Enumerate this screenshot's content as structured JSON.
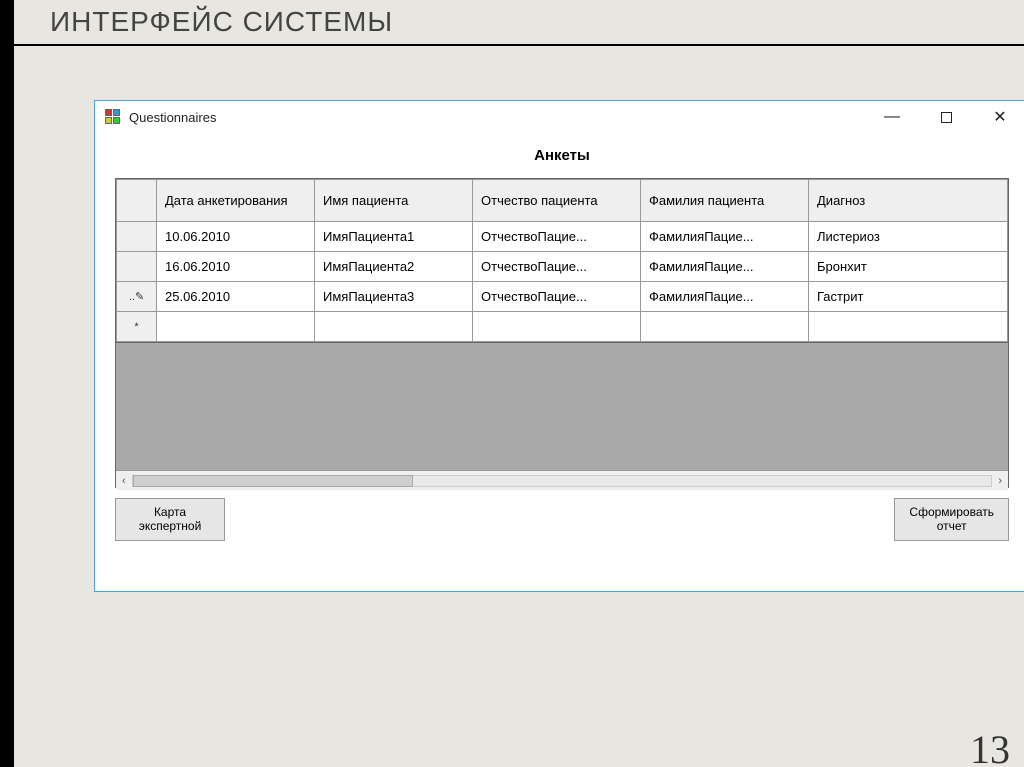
{
  "slide": {
    "title": "ИНТЕРФЕЙС СИСТЕМЫ",
    "page_number": "13"
  },
  "window": {
    "title": "Questionnaires",
    "controls": {
      "minimize": "—",
      "close": "✕"
    },
    "heading": "Анкеты",
    "columns": [
      "Дата анкетирования",
      "Имя пациента",
      "Отчество пациента",
      "Фамилия пациента",
      "Диагноз"
    ],
    "rows": [
      {
        "indicator": "",
        "cells": [
          "10.06.2010",
          "ИмяПациента1",
          "ОтчествоПацие...",
          "ФамилияПацие...",
          "Листериоз"
        ]
      },
      {
        "indicator": "",
        "cells": [
          "16.06.2010",
          "ИмяПациента2",
          "ОтчествоПацие...",
          "ФамилияПацие...",
          "Бронхит"
        ]
      },
      {
        "indicator": "..✎",
        "cells": [
          "25.06.2010",
          "ИмяПациента3",
          "ОтчествоПацие...",
          "ФамилияПацие...",
          "Гастрит"
        ]
      },
      {
        "indicator": "*",
        "cells": [
          "",
          "",
          "",
          "",
          ""
        ]
      }
    ],
    "buttons": {
      "expert_card": "Карта\nэкспертной",
      "report": "Сформировать\nотчет"
    },
    "scrollbar": {
      "left_arrow": "‹",
      "right_arrow": "›"
    }
  }
}
